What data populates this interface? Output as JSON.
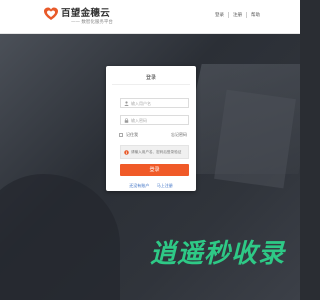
{
  "header": {
    "logo_name": "百望金穗云",
    "logo_slogan": "—— 数智化服务平台",
    "nav": [
      "登录",
      "注册",
      "帮助"
    ]
  },
  "login": {
    "title": "登录",
    "username_placeholder": "输入用户名",
    "password_placeholder": "输入密码",
    "remember_label": "记住我",
    "forgot_label": "忘记密码",
    "notice_text": "请输入用户名、密码后登录验证",
    "submit_label": "登录",
    "register_link": "还没有账户",
    "register_now": "马上注册"
  },
  "watermark": "逍遥秒收录",
  "colors": {
    "accent": "#f05a28",
    "link": "#3a6fc4",
    "watermark": "#2ec986"
  }
}
